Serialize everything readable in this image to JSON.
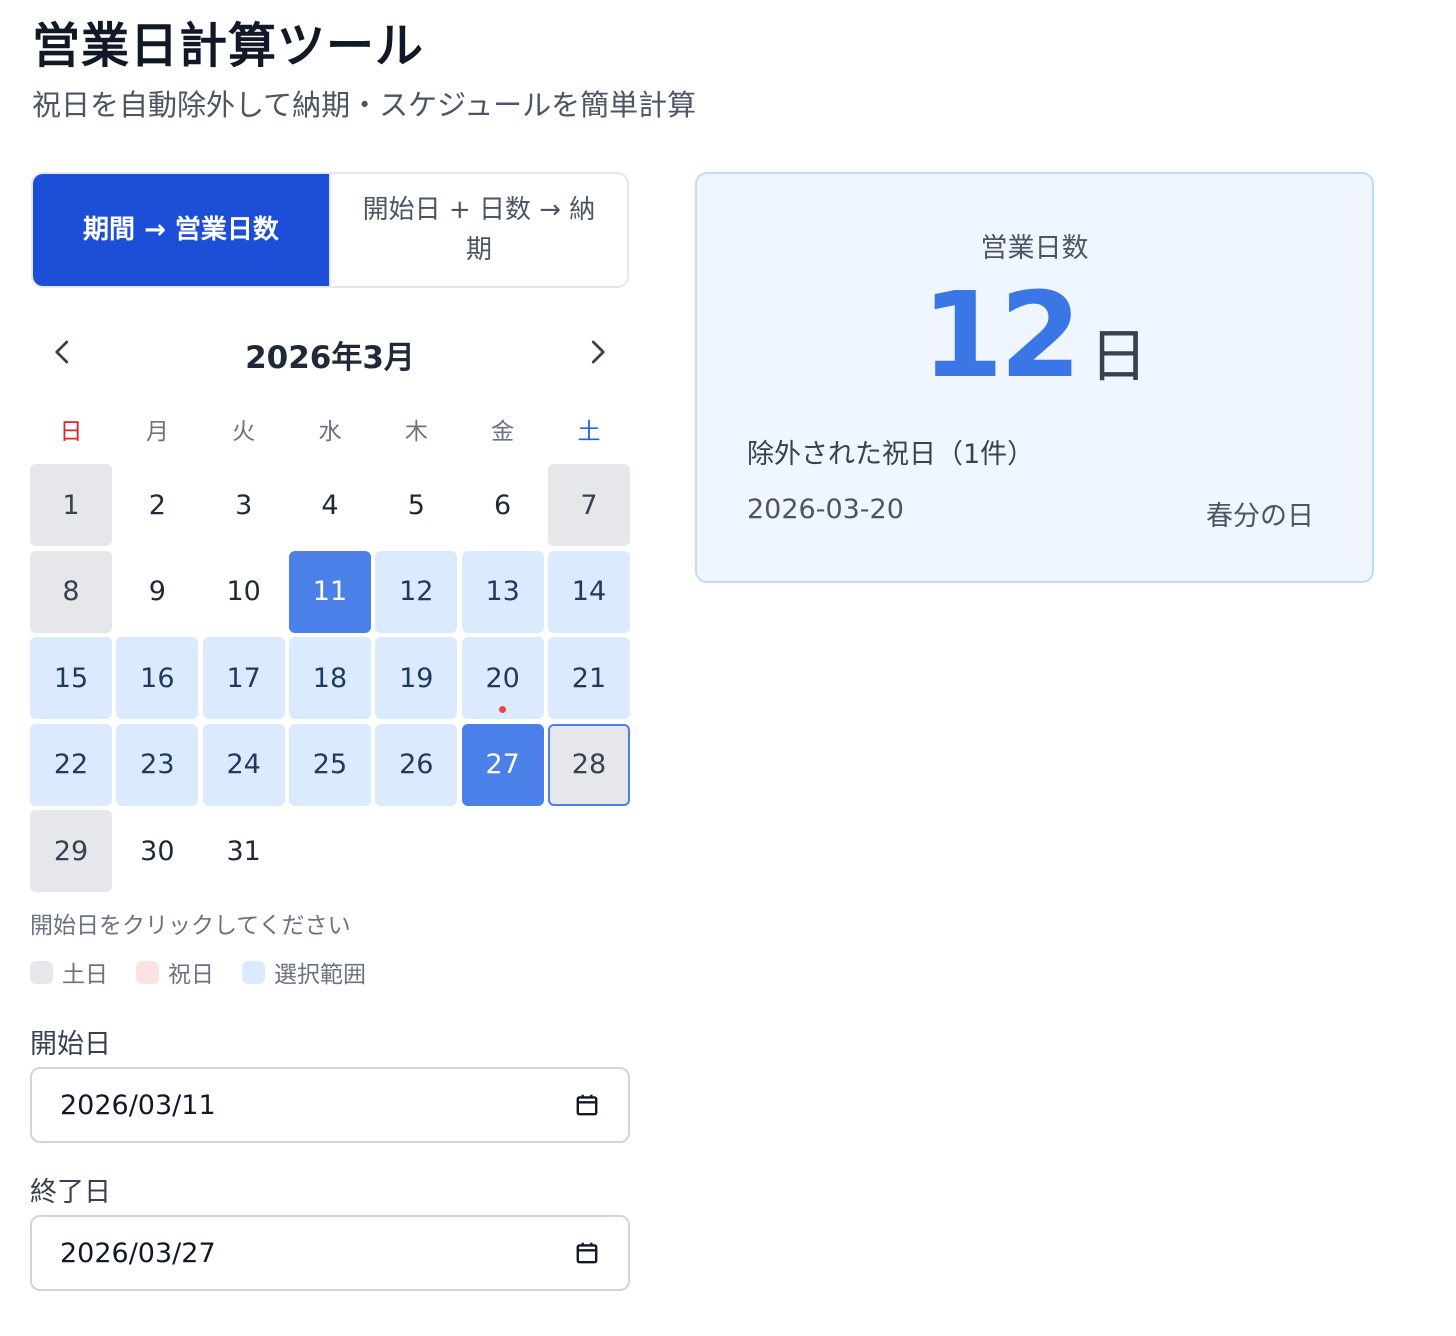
{
  "header": {
    "title": "営業日計算ツール",
    "subtitle": "祝日を自動除外して納期・スケジュールを簡単計算"
  },
  "mode_tabs": [
    {
      "label": "期間 → 営業日数",
      "active": true
    },
    {
      "label": "開始日 + 日数 → 納期",
      "active": false
    }
  ],
  "calendar": {
    "month_label": "2026年3月",
    "weekdays": [
      "日",
      "月",
      "火",
      "水",
      "木",
      "金",
      "土"
    ],
    "days": [
      {
        "n": "1",
        "state": "weekend"
      },
      {
        "n": "2",
        "state": "normal"
      },
      {
        "n": "3",
        "state": "normal"
      },
      {
        "n": "4",
        "state": "normal"
      },
      {
        "n": "5",
        "state": "normal"
      },
      {
        "n": "6",
        "state": "normal"
      },
      {
        "n": "7",
        "state": "weekend"
      },
      {
        "n": "8",
        "state": "weekend"
      },
      {
        "n": "9",
        "state": "normal"
      },
      {
        "n": "10",
        "state": "normal"
      },
      {
        "n": "11",
        "state": "selected"
      },
      {
        "n": "12",
        "state": "range"
      },
      {
        "n": "13",
        "state": "range"
      },
      {
        "n": "14",
        "state": "range"
      },
      {
        "n": "15",
        "state": "range"
      },
      {
        "n": "16",
        "state": "range"
      },
      {
        "n": "17",
        "state": "range"
      },
      {
        "n": "18",
        "state": "range"
      },
      {
        "n": "19",
        "state": "range"
      },
      {
        "n": "20",
        "state": "range",
        "holiday": true
      },
      {
        "n": "21",
        "state": "range"
      },
      {
        "n": "22",
        "state": "range"
      },
      {
        "n": "23",
        "state": "range"
      },
      {
        "n": "24",
        "state": "range"
      },
      {
        "n": "25",
        "state": "range"
      },
      {
        "n": "26",
        "state": "range"
      },
      {
        "n": "27",
        "state": "selected"
      },
      {
        "n": "28",
        "state": "weekend",
        "outlined": true
      },
      {
        "n": "29",
        "state": "weekend"
      },
      {
        "n": "30",
        "state": "normal"
      },
      {
        "n": "31",
        "state": "normal"
      }
    ],
    "hint": "開始日をクリックしてください"
  },
  "legend": [
    {
      "label": "土日",
      "kind": "weekend"
    },
    {
      "label": "祝日",
      "kind": "holiday"
    },
    {
      "label": "選択範囲",
      "kind": "range"
    }
  ],
  "form": {
    "start_label": "開始日",
    "start_value": "2026/03/11",
    "end_label": "終了日",
    "end_value": "2026/03/27"
  },
  "result": {
    "label": "営業日数",
    "value": "12",
    "unit": "日",
    "excluded_heading": "除外された祝日（1件）",
    "holidays": [
      {
        "date": "2026-03-20",
        "name": "春分の日"
      }
    ]
  },
  "colors": {
    "primary": "#1d4ed8",
    "selected": "#4a80e8",
    "range": "#dbeafe",
    "weekend": "#e5e7eb",
    "holiday_dot": "#ef4444",
    "result_number": "#3b76e6"
  }
}
